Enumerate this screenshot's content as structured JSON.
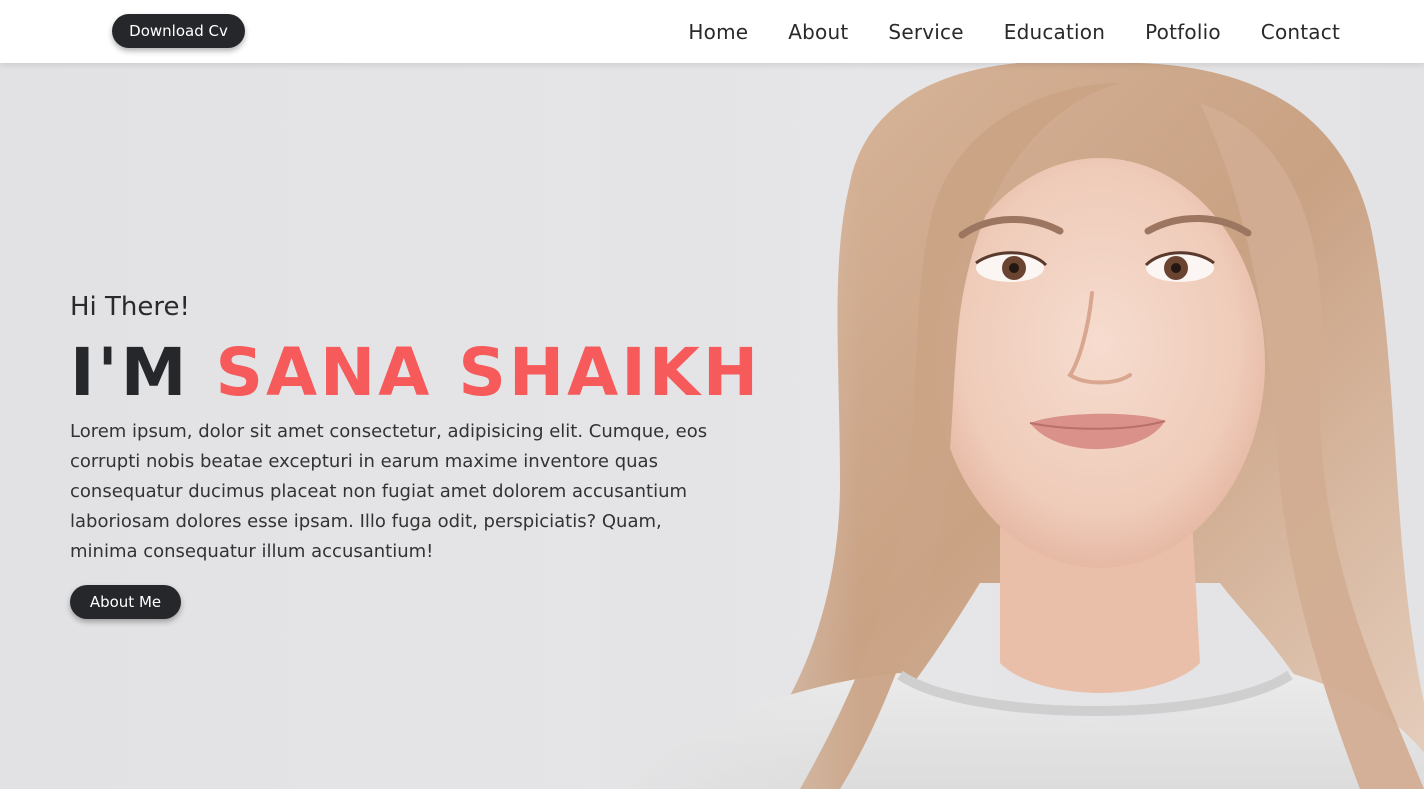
{
  "header": {
    "cv_button_label": "Download Cv",
    "nav": [
      "Home",
      "About",
      "Service",
      "Education",
      "Potfolio",
      "Contact"
    ]
  },
  "hero": {
    "greeting": "Hi There!",
    "headline_prefix": "I'M",
    "headline_name": "SANA SHAIKH",
    "intro": "Lorem ipsum, dolor sit amet consectetur, adipisicing elit. Cumque, eos corrupti nobis beatae excepturi in earum maxime inventore quas consequatur ducimus placeat non fugiat amet dolorem accusantium laboriosam dolores esse ipsam. Illo fuga odit, perspiciatis? Quam, minima consequatur illum accusantium!",
    "about_button_label": "About Me"
  },
  "colors": {
    "accent": "#f65a5b",
    "dark": "#25272a",
    "background": "#e4e4e6",
    "header_background": "#ffffff"
  }
}
